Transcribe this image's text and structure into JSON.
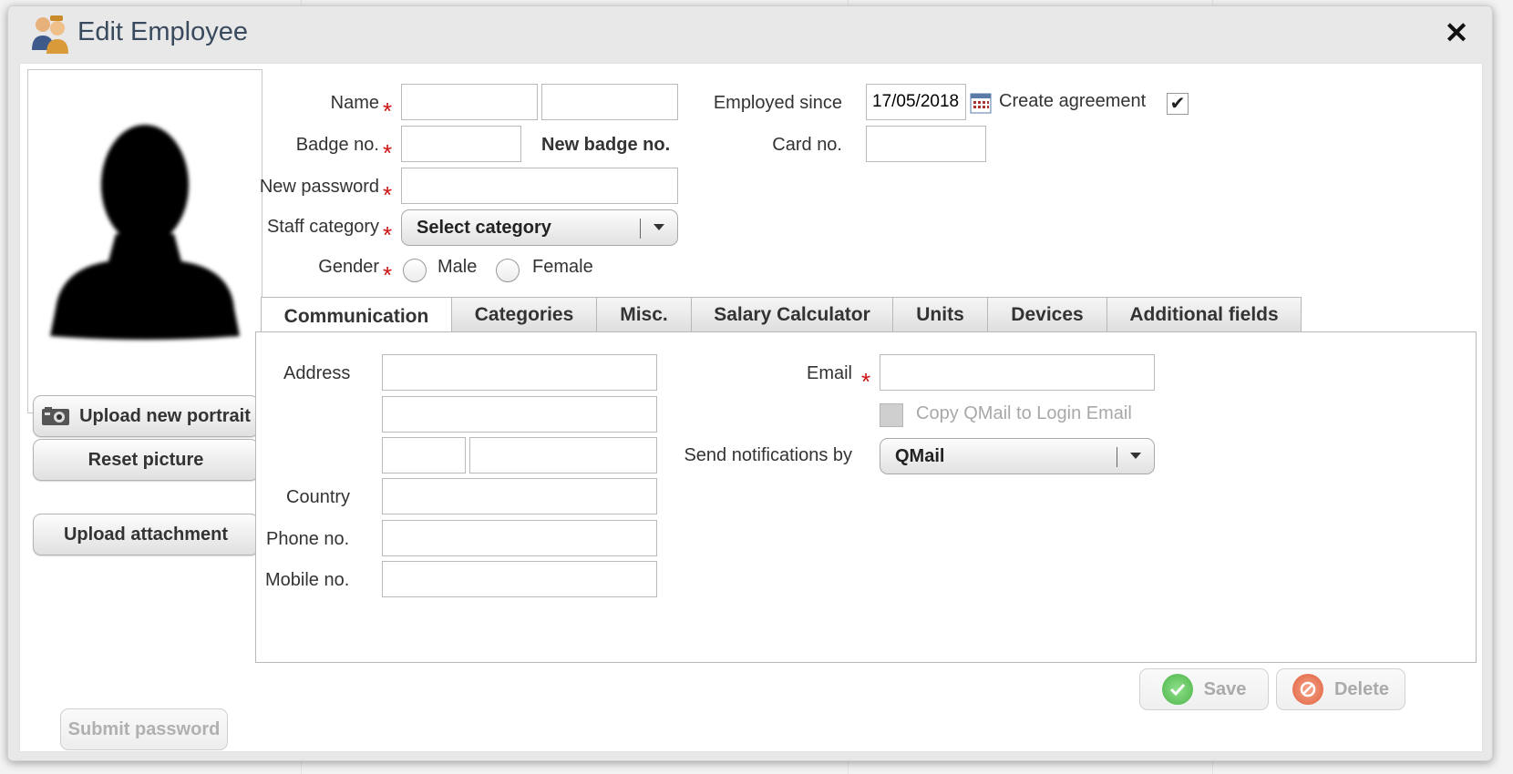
{
  "window": {
    "title": "Edit Employee",
    "close_icon": "close-icon"
  },
  "portrait": {
    "upload_label": "Upload new portrait",
    "reset_label": "Reset picture",
    "attachment_label": "Upload attachment",
    "submit_password_label": "Submit password"
  },
  "form": {
    "name_label": "Name",
    "badge_label": "Badge no.",
    "new_badge_label": "New badge no.",
    "password_label": "New password",
    "staff_category_label": "Staff category",
    "staff_category_value": "Select category",
    "gender_label": "Gender",
    "gender_male": "Male",
    "gender_female": "Female",
    "employed_since_label": "Employed since",
    "employed_since_value": "17/05/2018",
    "create_agreement_label": "Create agreement",
    "create_agreement_checked": "✔",
    "card_label": "Card no."
  },
  "tabs": [
    "Communication",
    "Categories",
    "Misc.",
    "Salary Calculator",
    "Units",
    "Devices",
    "Additional fields"
  ],
  "communication": {
    "address_label": "Address",
    "country_label": "Country",
    "phone_label": "Phone no.",
    "mobile_label": "Mobile no.",
    "email_label": "Email",
    "copy_qmail_label": "Copy QMail to Login Email",
    "notifications_label": "Send notifications by",
    "notifications_value": "QMail"
  },
  "actions": {
    "save_label": "Save",
    "delete_label": "Delete"
  },
  "colors": {
    "required": "#cc1111",
    "title": "#3a4a5e",
    "save_icon": "#5fc45a",
    "delete_icon": "#e8795a"
  }
}
